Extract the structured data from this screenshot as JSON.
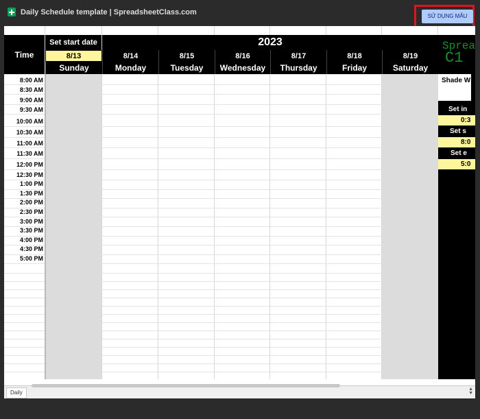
{
  "header": {
    "title": "Daily Schedule template | SpreadsheetClass.com",
    "use_template_label": "SỬ DỤNG MẪU"
  },
  "schedule": {
    "time_header": "Time",
    "start_date_label": "Set start date",
    "year": "2023",
    "dates": [
      "8/13",
      "8/14",
      "8/15",
      "8/16",
      "8/17",
      "8/18",
      "8/19"
    ],
    "days": [
      "Sunday",
      "Monday",
      "Tuesday",
      "Wednesday",
      "Thursday",
      "Friday",
      "Saturday"
    ],
    "times": [
      "8:00 AM",
      "8:30 AM",
      "9:00 AM",
      "9:30 AM",
      "10:00 AM",
      "10:30 AM",
      "11:00 AM",
      "11:30 AM",
      "12:00 PM",
      "12:30 PM",
      "1:00 PM",
      "1:30 PM",
      "2:00 PM",
      "2:30 PM",
      "3:00 PM",
      "3:30 PM",
      "4:00 PM",
      "4:30 PM",
      "5:00 PM"
    ]
  },
  "side_panel": {
    "brand_line1": "Sprea",
    "brand_line2": "C1",
    "shade_label": "Shade W",
    "interval_label": "Set in",
    "interval_value": "0:3",
    "start_label": "Set s",
    "start_value": "8:0",
    "end_label": "Set e",
    "end_value": "5:0"
  },
  "footer": {
    "sheet_tab": "Daily"
  },
  "colors": {
    "highlight": "#fff59d",
    "weekend_shade": "#dcdcdc",
    "header_black": "#000000",
    "brand_green": "#1b8f2e",
    "button_blue": "#aecbfa",
    "callout_red": "#e0141f"
  }
}
